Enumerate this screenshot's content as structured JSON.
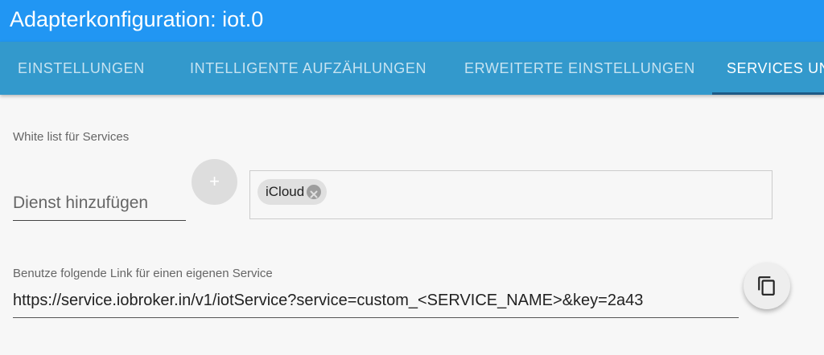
{
  "window": {
    "title": "Adapterkonfiguration: iot.0"
  },
  "tabs": [
    {
      "label": "EINSTELLUNGEN",
      "active": false
    },
    {
      "label": "INTELLIGENTE AUFZÄHLUNGEN",
      "active": false
    },
    {
      "label": "ERWEITERTE EINSTELLUNGEN",
      "active": false
    },
    {
      "label": "SERVICES UN",
      "active": true
    }
  ],
  "services": {
    "whitelist_label": "White list für Services",
    "add_input_placeholder": "Dienst hinzufügen",
    "add_button_label": "+",
    "chips": [
      {
        "label": "iCloud"
      }
    ]
  },
  "custom_link": {
    "label": "Benutze folgende Link für einen eigenen Service",
    "value": "https://service.iobroker.in/v1/iotService?service=custom_<SERVICE_NAME>&key=2a43",
    "copy_icon": "copy-icon"
  },
  "colors": {
    "titlebar": "#2196f3",
    "tabbar": "#3399cc",
    "tab_indicator": "#1e5a86",
    "background": "#f7f7f7"
  }
}
